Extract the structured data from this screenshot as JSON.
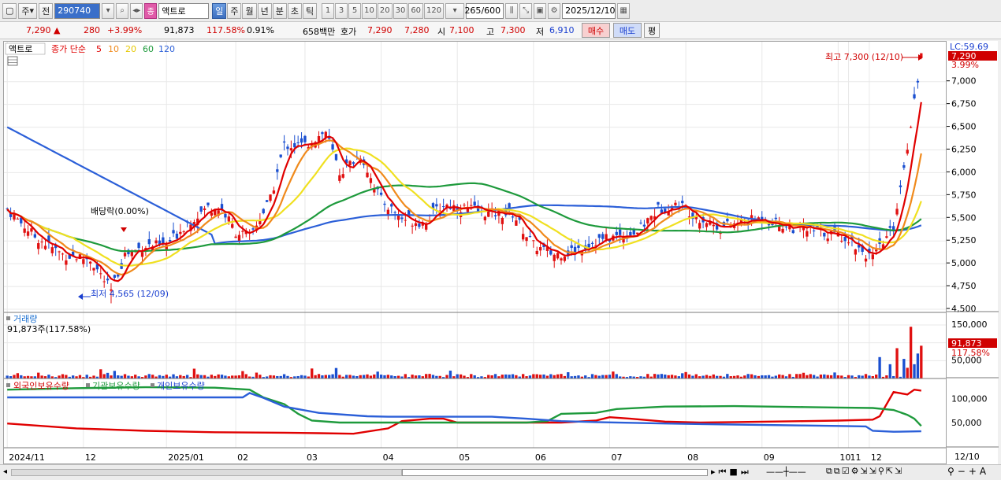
{
  "toolbar": {
    "market": "주",
    "prev_label": "전",
    "code": "290740",
    "tag": "종",
    "name": "액트로",
    "periods": [
      "일",
      "주",
      "월",
      "년",
      "분",
      "초",
      "틱"
    ],
    "active_period": "일",
    "intervals": [
      "1",
      "3",
      "5",
      "10",
      "20",
      "30",
      "60",
      "120"
    ],
    "count": "265",
    "count_max": "/600",
    "date": "2025/12/10"
  },
  "quote": {
    "price": "7,290",
    "change_arrow": "▲",
    "change": "280",
    "change_pct": "+3.99%",
    "volume": "91,873",
    "volume_ratio": "117.58%",
    "turnover_rate": "0.91%",
    "amount": "658백만",
    "ask_label": "호가",
    "ask": "7,290",
    "bid": "7,280",
    "open_label": "시",
    "open": "7,100",
    "high_label": "고",
    "high": "7,300",
    "low_label": "저",
    "low": "6,910",
    "buy_label": "매수",
    "sell_label": "매도",
    "avg_label": "평"
  },
  "price_panel": {
    "name": "액트로",
    "ma_title": "종가 단순",
    "ma_periods": [
      "5",
      "10",
      "20",
      "60",
      "120"
    ],
    "lc_label": "LC:59.69",
    "last_price": "7,290",
    "last_pct": "3.99%",
    "high_note": "최고 7,300 (12/10)",
    "low_note": "최저 4,565 (12/09)",
    "dividend_note": "배당락(0.00%)",
    "ticks": [
      "7,000",
      "6,750",
      "6,500",
      "6,250",
      "6,000",
      "5,750",
      "5,500",
      "5,250",
      "5,000",
      "4,750",
      "4,500"
    ]
  },
  "volume_panel": {
    "title": "거래량",
    "value_line": "91,873주(117.58%)",
    "last_value": "91,873",
    "last_pct": "117.58%",
    "ticks": [
      "150,000",
      "100,000",
      "50,000"
    ]
  },
  "holding_panel": {
    "legend": [
      "외국인보유수량",
      "기관보유수량",
      "개인보유수량"
    ],
    "ticks": [
      "100,000",
      "50,000"
    ]
  },
  "x_axis": {
    "labels": [
      "2024/11",
      "12",
      "2025/01",
      "02",
      "03",
      "04",
      "05",
      "06",
      "07",
      "08",
      "09",
      "10",
      "11",
      "12"
    ],
    "right_label": "12/10"
  },
  "colors": {
    "ma5": "#e00000",
    "ma10": "#f08a1c",
    "ma20": "#f0e020",
    "ma60": "#1e9a3c",
    "ma120": "#2b5fd8",
    "up": "#e01010",
    "down": "#1a4fd0"
  },
  "chart_data": {
    "type": "candlestick",
    "price_anchors": [
      [
        "2024/11 start",
        5600
      ],
      [
        "12",
        5050
      ],
      [
        "12/09 low",
        4565
      ],
      [
        "2025/01",
        5250
      ],
      [
        "01 mid",
        5700
      ],
      [
        "02",
        5250
      ],
      [
        "02 mid",
        6300
      ],
      [
        "03",
        6500
      ],
      [
        "03 mid",
        5900
      ],
      [
        "04",
        5500
      ],
      [
        "05",
        5600
      ],
      [
        "06",
        5100
      ],
      [
        "07",
        5300
      ],
      [
        "08",
        5600
      ],
      [
        "09",
        5400
      ],
      [
        "10",
        5350
      ],
      [
        "11",
        5000
      ],
      [
        "11 late",
        6000
      ],
      [
        "12",
        6300
      ],
      [
        "12/10",
        7290
      ]
    ],
    "price_range": [
      4500,
      7300
    ],
    "volume_range": [
      0,
      150000
    ],
    "holding_range": [
      0,
      120000
    ]
  }
}
